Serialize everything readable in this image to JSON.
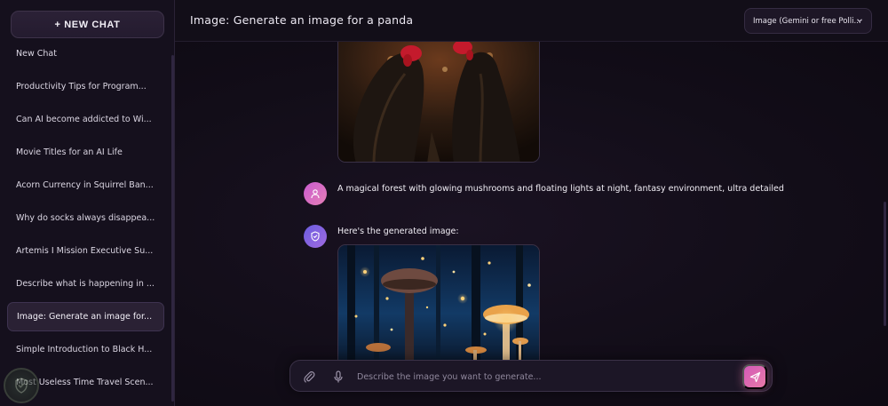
{
  "sidebar": {
    "new_chat_label": "+ NEW CHAT",
    "history": [
      {
        "label": "New Chat",
        "active": false
      },
      {
        "label": "Productivity Tips for Program...",
        "active": false
      },
      {
        "label": "Can AI become addicted to Wi...",
        "active": false
      },
      {
        "label": "Movie Titles for an AI Life",
        "active": false
      },
      {
        "label": "Acorn Currency in Squirrel Ban...",
        "active": false
      },
      {
        "label": "Why do socks always disappea...",
        "active": false
      },
      {
        "label": "Artemis I Mission Executive Su...",
        "active": false
      },
      {
        "label": "Describe what is happening in ...",
        "active": false
      },
      {
        "label": "Image: Generate an image for...",
        "active": true
      },
      {
        "label": "Simple Introduction to Black H...",
        "active": false
      },
      {
        "label": "Most Useless Time Travel Scen...",
        "active": false
      }
    ]
  },
  "header": {
    "title": "Image: Generate an image for a panda",
    "model_select": "Image (Gemini or free Polli..."
  },
  "messages": {
    "user_prompt": "A magical forest with glowing mushrooms and floating lights at night, fantasy environment, ultra detailed",
    "assistant_reply": "Here's the generated image:"
  },
  "composer": {
    "placeholder": "Describe the image you want to generate..."
  },
  "icons": {
    "user_avatar": "user-icon",
    "assistant_avatar": "shield-icon",
    "attach": "paperclip-icon",
    "mic": "microphone-icon",
    "send": "send-icon",
    "dropdown": "chevron-down-icon"
  },
  "colors": {
    "accent_pink": "#e57fb6",
    "accent_purple": "#6b5ce0",
    "sidebar_bg": "#15101d",
    "main_bg": "#120d18"
  }
}
